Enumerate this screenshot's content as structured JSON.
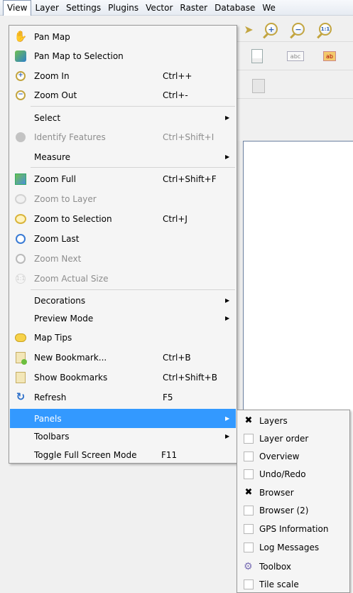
{
  "menubar": {
    "items": [
      {
        "label": "View",
        "active": true
      },
      {
        "label": "Layer"
      },
      {
        "label": "Settings"
      },
      {
        "label": "Plugins"
      },
      {
        "label": "Vector"
      },
      {
        "label": "Raster"
      },
      {
        "label": "Database"
      },
      {
        "label": "We"
      }
    ]
  },
  "toolbar": {
    "zoom_in_glyph": "+",
    "zoom_out_glyph": "−",
    "zoom_actual_glyph": "1:1",
    "label_abc": "abc",
    "label_abc_hot": "ab"
  },
  "view_menu": {
    "items": [
      {
        "label": "Pan Map",
        "icon": "hand-icon"
      },
      {
        "label": "Pan Map to Selection",
        "icon": "pan-selection-icon"
      },
      {
        "label": "Zoom In",
        "shortcut": "Ctrl++",
        "icon": "zoom-in-icon",
        "glyph": "+"
      },
      {
        "label": "Zoom Out",
        "shortcut": "Ctrl+-",
        "icon": "zoom-out-icon",
        "glyph": "−"
      },
      {
        "label": "Select",
        "submenu": true
      },
      {
        "label": "Identify Features",
        "shortcut": "Ctrl+Shift+I",
        "disabled": true,
        "icon": "identify-icon"
      },
      {
        "label": "Measure",
        "submenu": true
      },
      {
        "label": "Zoom Full",
        "shortcut": "Ctrl+Shift+F",
        "icon": "zoom-full-icon"
      },
      {
        "label": "Zoom to Layer",
        "disabled": true,
        "icon": "zoom-layer-icon"
      },
      {
        "label": "Zoom to Selection",
        "shortcut": "Ctrl+J",
        "icon": "zoom-selection-icon"
      },
      {
        "label": "Zoom Last",
        "icon": "zoom-last-icon"
      },
      {
        "label": "Zoom Next",
        "disabled": true,
        "icon": "zoom-next-icon"
      },
      {
        "label": "Zoom Actual Size",
        "disabled": true,
        "icon": "zoom-actual-icon",
        "glyph": "1:1"
      },
      {
        "label": "Decorations",
        "submenu": true
      },
      {
        "label": "Preview Mode",
        "submenu": true
      },
      {
        "label": "Map Tips",
        "icon": "map-tips-icon"
      },
      {
        "label": "New Bookmark...",
        "shortcut": "Ctrl+B",
        "icon": "new-bookmark-icon"
      },
      {
        "label": "Show Bookmarks",
        "shortcut": "Ctrl+Shift+B",
        "icon": "show-bookmarks-icon"
      },
      {
        "label": "Refresh",
        "shortcut": "F5",
        "icon": "refresh-icon"
      },
      {
        "label": "Panels",
        "submenu": true,
        "highlighted": true
      },
      {
        "label": "Toolbars",
        "submenu": true
      },
      {
        "label": "Toggle Full Screen Mode",
        "shortcut": "F11"
      }
    ],
    "submenu_arrow": "▶"
  },
  "panels_submenu": {
    "check_mark": "✖",
    "items": [
      {
        "label": "Layers",
        "checked": true
      },
      {
        "label": "Layer order",
        "checked": false
      },
      {
        "label": "Overview",
        "checked": false
      },
      {
        "label": "Undo/Redo",
        "checked": false
      },
      {
        "label": "Browser",
        "checked": true
      },
      {
        "label": "Browser (2)",
        "checked": false
      },
      {
        "label": "GPS Information",
        "checked": false
      },
      {
        "label": "Log Messages",
        "checked": false
      },
      {
        "label": "Toolbox",
        "gear": true
      },
      {
        "label": "Tile scale",
        "checked": false
      }
    ]
  },
  "icons": {
    "hand": "✋",
    "refresh": "↻",
    "gear": "⚙"
  }
}
